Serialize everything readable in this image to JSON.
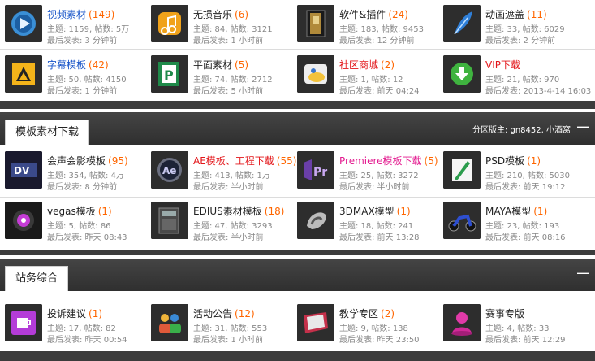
{
  "section1": {
    "rows": [
      [
        {
          "name": "视频素材",
          "color": "blue",
          "count": "(149)",
          "stats": "主题: 1159, 帖数: 5万",
          "last": "最后发表: 3 分钟前",
          "icon": "video-play-icon"
        },
        {
          "name": "无损音乐",
          "color": "",
          "count": "(6)",
          "stats": "主题: 84, 帖数: 3121",
          "last": "最后发表: 1 小时前",
          "icon": "music-icon"
        },
        {
          "name": "软件&插件",
          "color": "",
          "count": "(24)",
          "stats": "主题: 183, 帖数: 9453",
          "last": "最后发表: 12 分钟前",
          "icon": "software-box-icon"
        },
        {
          "name": "动画遮盖",
          "color": "",
          "count": "(11)",
          "stats": "主题: 33, 帖数: 6029",
          "last": "最后发表: 2 分钟前",
          "icon": "feather-icon"
        }
      ],
      [
        {
          "name": "字幕模板",
          "color": "blue",
          "count": "(42)",
          "stats": "主题: 50, 帖数: 4150",
          "last": "最后发表: 1 分钟前",
          "icon": "subtitle-icon"
        },
        {
          "name": "平面素材",
          "color": "",
          "count": "(5)",
          "stats": "主题: 74, 帖数: 2712",
          "last": "最后发表: 5 小时前",
          "icon": "design-icon"
        },
        {
          "name": "社区商城",
          "color": "red",
          "count": "(2)",
          "stats": "主题: 1, 帖数: 12",
          "last": "最后发表: 前天 04:24",
          "icon": "shop-icon"
        },
        {
          "name": "VIP下载",
          "color": "red",
          "count": "",
          "stats": "主题: 21, 帖数: 970",
          "last": "最后发表: 2013-4-14 16:03",
          "icon": "download-icon"
        }
      ]
    ]
  },
  "section2": {
    "title": "模板素材下载",
    "moderators": "分区版主: gn8452, 小酒窝",
    "collapse": "—",
    "rows": [
      [
        {
          "name": "会声会影模板",
          "color": "",
          "count": "(95)",
          "stats": "主题: 354, 帖数: 4万",
          "last": "最后发表: 8 分钟前",
          "icon": "dv-icon"
        },
        {
          "name": "AE模板、工程下载",
          "color": "red",
          "count": "(55)",
          "stats": "主题: 413, 帖数: 1万",
          "last": "最后发表: 半小时前",
          "icon": "ae-icon"
        },
        {
          "name": "Premiere模板下载",
          "color": "pink",
          "count": "(5)",
          "stats": "主题: 25, 帖数: 3272",
          "last": "最后发表: 半小时前",
          "icon": "premiere-icon"
        },
        {
          "name": "PSD模板",
          "color": "",
          "count": "(1)",
          "stats": "主题: 210, 帖数: 5030",
          "last": "最后发表: 前天 19:12",
          "icon": "psd-icon"
        }
      ],
      [
        {
          "name": "vegas模板",
          "color": "",
          "count": "(1)",
          "stats": "主题: 5, 帖数: 86",
          "last": "最后发表: 昨天 08:43",
          "icon": "vegas-icon"
        },
        {
          "name": "EDIUS素材模板",
          "color": "",
          "count": "(18)",
          "stats": "主题: 47, 帖数: 3293",
          "last": "最后发表: 半小时前",
          "icon": "edius-icon"
        },
        {
          "name": "3DMAX模型",
          "color": "",
          "count": "(1)",
          "stats": "主题: 18, 帖数: 241",
          "last": "最后发表: 前天 13:28",
          "icon": "3dmax-icon"
        },
        {
          "name": "MAYA模型",
          "color": "",
          "count": "(1)",
          "stats": "主题: 23, 帖数: 193",
          "last": "最后发表: 前天 08:16",
          "icon": "motorbike-icon"
        }
      ]
    ]
  },
  "section3": {
    "title": "站务综合",
    "collapse": "—",
    "rows": [
      [
        {
          "name": "投诉建议",
          "color": "",
          "count": "(1)",
          "stats": "主题: 17, 帖数: 82",
          "last": "最后发表: 昨天 00:54",
          "icon": "cup-icon"
        },
        {
          "name": "活动公告",
          "color": "",
          "count": "(12)",
          "stats": "主题: 31, 帖数: 553",
          "last": "最后发表: 1 小时前",
          "icon": "people-icon"
        },
        {
          "name": "教学专区",
          "color": "",
          "count": "(2)",
          "stats": "主题: 9, 帖数: 138",
          "last": "最后发表: 昨天 23:50",
          "icon": "book-icon"
        },
        {
          "name": "赛事专版",
          "color": "",
          "count": "",
          "stats": "主题: 4, 帖数: 33",
          "last": "最后发表: 前天 12:29",
          "icon": "trophy-icon"
        }
      ]
    ]
  }
}
